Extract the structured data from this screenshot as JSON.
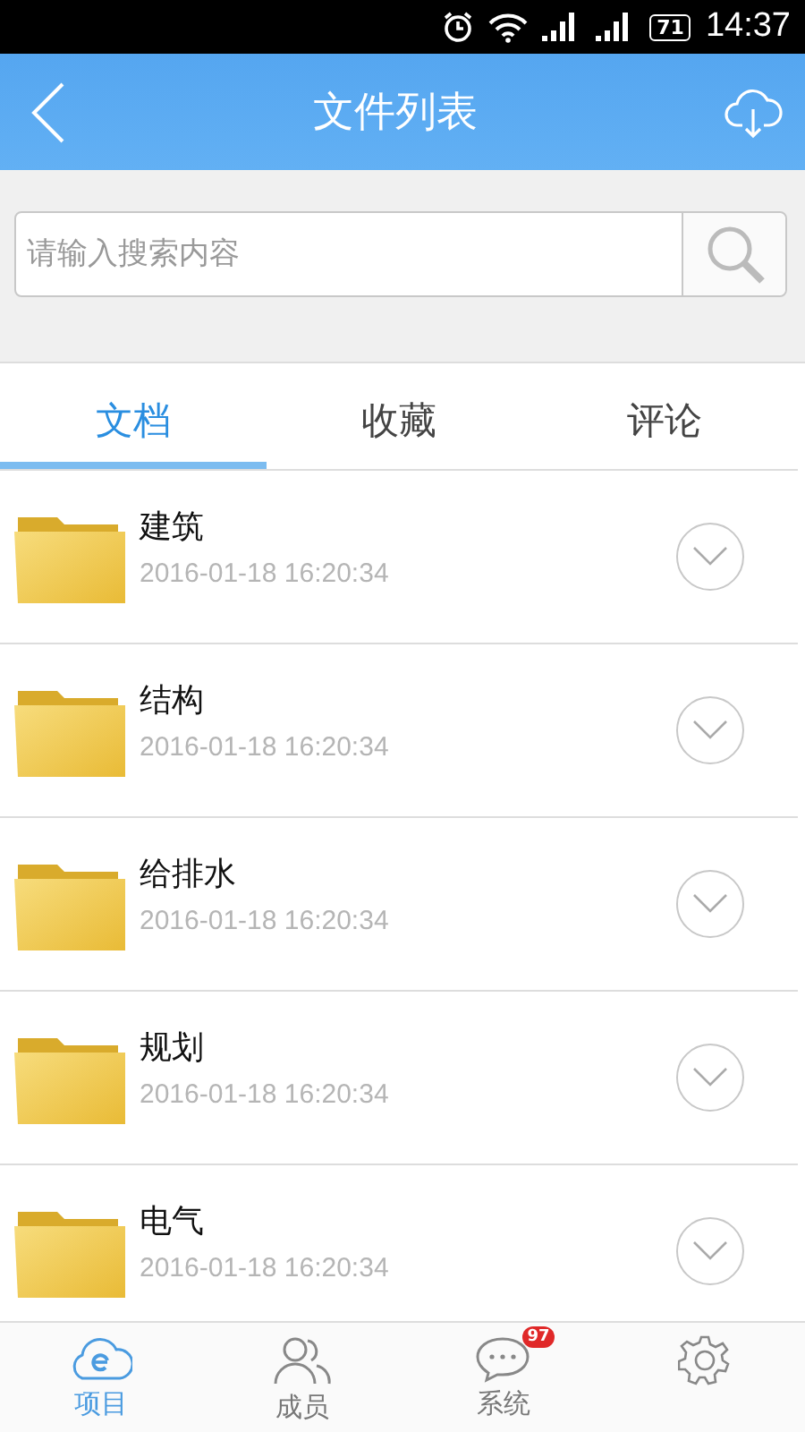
{
  "status_bar": {
    "battery": "71",
    "time": "14:37"
  },
  "header": {
    "title": "文件列表"
  },
  "search": {
    "placeholder": "请输入搜索内容"
  },
  "tabs": [
    {
      "label": "文档",
      "selected": true
    },
    {
      "label": "收藏",
      "selected": false
    },
    {
      "label": "评论",
      "selected": false
    }
  ],
  "files": [
    {
      "name": "建筑",
      "date": "2016-01-18 16:20:34"
    },
    {
      "name": "结构",
      "date": "2016-01-18 16:20:34"
    },
    {
      "name": "给排水",
      "date": "2016-01-18 16:20:34"
    },
    {
      "name": "规划",
      "date": "2016-01-18 16:20:34"
    },
    {
      "name": "电气",
      "date": "2016-01-18 16:20:34"
    }
  ],
  "bottom_nav": [
    {
      "kind": "cloud",
      "label": "项目",
      "selected": true
    },
    {
      "kind": "people",
      "label": "成员",
      "selected": false
    },
    {
      "kind": "chat",
      "label": "系统",
      "badge": "97",
      "selected": false
    },
    {
      "kind": "gear",
      "selected": false
    }
  ]
}
